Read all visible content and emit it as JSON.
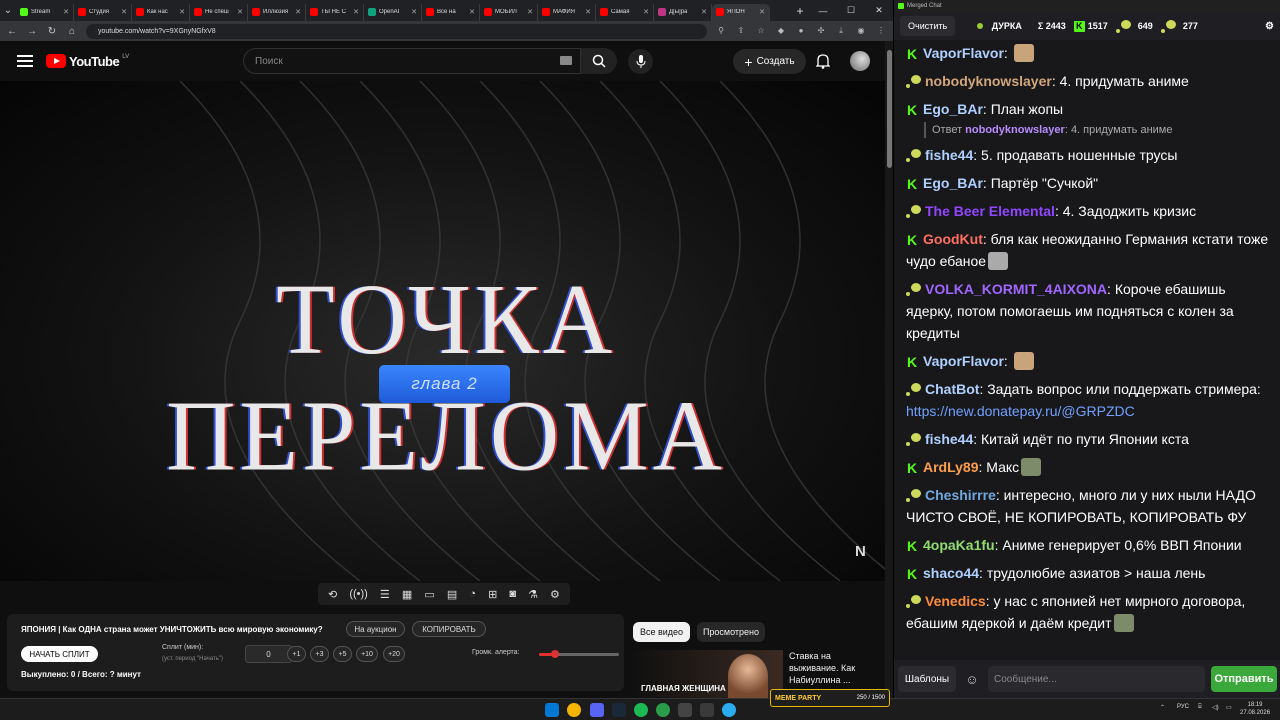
{
  "browser": {
    "tabs": [
      {
        "label": "Stream",
        "favicon": "kick"
      },
      {
        "label": "Студия",
        "favicon": "youtube"
      },
      {
        "label": "Как нас",
        "favicon": "youtube"
      },
      {
        "label": "Не спеш",
        "favicon": "youtube"
      },
      {
        "label": "Иллюзия",
        "favicon": "youtube"
      },
      {
        "label": "ТЫ НЕ С",
        "favicon": "youtube"
      },
      {
        "label": "OpenAI",
        "favicon": "openai"
      },
      {
        "label": "Все на",
        "favicon": "youtube"
      },
      {
        "label": "МОБИЛ",
        "favicon": "youtube"
      },
      {
        "label": "МАФИЯ",
        "favicon": "youtube"
      },
      {
        "label": "Самая",
        "favicon": "youtube"
      },
      {
        "label": "Д[ы]ра",
        "favicon": "instagram"
      },
      {
        "label": "ЯПОН",
        "favicon": "youtube",
        "active": true
      }
    ],
    "url": "youtube.com/watch?v=9XGnyNGfxV8"
  },
  "youtube": {
    "logo_text": "YouTube",
    "country_code": "LV",
    "search_placeholder": "Поиск",
    "create_label": "Создать"
  },
  "video": {
    "title_overlay": "ТОЧКА ПЕРЕЛОМА",
    "chapter": "глава 2"
  },
  "split_panel": {
    "title": "ЯПОНИЯ | Как ОДНА страна может УНИЧТОЖИТЬ всю мировую экономику?",
    "auction_btn": "На аукцион",
    "copy_btn": "КОПИРОВАТЬ",
    "start_btn": "НАЧАТЬ СПЛИТ",
    "split_label": "Сплит (мин):",
    "split_hint": "(уст. период \"Начать\")",
    "split_value": "0",
    "increments": [
      "+1",
      "+3",
      "+5",
      "+10",
      "+20"
    ],
    "alert_volume_label": "Громк. алерта:",
    "alert_volume_fraction": 0.2,
    "status": "Выкуплено: 0 / Всего: ? минут"
  },
  "recommendations": {
    "chips": [
      "Все видео",
      "Просмотрено"
    ],
    "card_thumb_text": "ГЛАВНАЯ ЖЕНЩИНА",
    "card_title": "Ставка на выживание. Как Набиуллина ..."
  },
  "meme_party": {
    "label": "MEME PARTY",
    "progress": "250 / 1500"
  },
  "chat": {
    "window_title": "Merged Chat",
    "clear_btn": "Очистить",
    "channel": "ДУРКА",
    "total": "Σ 2443",
    "kick_count": "1517",
    "twitch_count": "649",
    "other_count": "277",
    "messages": [
      {
        "platform": "kick",
        "user": "VaporFlavor",
        "color": "#b0d0ff",
        "text": "",
        "emote": true
      },
      {
        "platform": "twitch",
        "user": "nobodyknowslayer",
        "color": "#d2a679",
        "text": "4. придумать аниме"
      },
      {
        "platform": "kick",
        "user": "Ego_BAr",
        "color": "#b0d0ff",
        "text": "План жопы"
      },
      {
        "platform": "twitch",
        "user": "fishe44",
        "color": "#b0d0ff",
        "text": "5. продавать ношенные трусы"
      },
      {
        "platform": "kick",
        "user": "Ego_BAr",
        "color": "#b0d0ff",
        "text": "Партёр \"Сучкой\""
      },
      {
        "platform": "twitch",
        "user": "The Beer Elemental",
        "color": "#9146ff",
        "text": "4. Задоджить кризис"
      },
      {
        "platform": "kick",
        "user": "GoodKut",
        "color": "#ff6f61",
        "text": "бля как неожиданно Германия кстати тоже чудо ебаное",
        "emote": true
      },
      {
        "platform": "twitch",
        "user": "VOLKA_KORMIT_4AIXONA",
        "color": "#a066ff",
        "text": "Короче ебашишь ядерку, потом помогаешь им подняться с колен за кредиты"
      },
      {
        "platform": "kick",
        "user": "VaporFlavor",
        "color": "#b0d0ff",
        "text": "",
        "emote": true
      },
      {
        "platform": "twitch",
        "user": "ChatBot",
        "color": "#b0d0ff",
        "text": "Задать вопрос или поддержать стримера: ",
        "link": "https://new.donatepay.ru/@GRPZDC"
      },
      {
        "platform": "twitch",
        "user": "fishe44",
        "color": "#b0d0ff",
        "text": "Китай идёт по пути Японии кста"
      },
      {
        "platform": "kick",
        "user": "ArdLy89",
        "color": "#ff9e4d",
        "text": "Макс",
        "emote": true
      },
      {
        "platform": "twitch",
        "user": "Cheshirrre",
        "color": "#6fa8dc",
        "text": "интересно, много ли у них ныли НАДО ЧИСТО СВОЁ, НЕ КОПИРОВАТЬ, КОПИРОВАТЬ ФУ"
      },
      {
        "platform": "kick",
        "user": "4opaKa1fu",
        "color": "#8fdc6f",
        "text": "Аниме генерирует 0,6% ВВП Японии"
      },
      {
        "platform": "kick",
        "user": "shaco44",
        "color": "#b0d0ff",
        "text": "трудолюбие азиатов > наша лень"
      },
      {
        "platform": "twitch",
        "user": "Venedics",
        "color": "#ff8c3a",
        "text": "у нас с японией нет мирного договора, ебашим ядеркой и даём кредит",
        "emote": true
      }
    ],
    "reply": {
      "prefix": "Ответ",
      "user": "nobodyknowslayer",
      "text": "4. придумать аниме"
    },
    "templates_btn": "Шаблоны",
    "input_placeholder": "Сообщение...",
    "send_btn": "Отправить"
  },
  "taskbar": {
    "lang": "РУС",
    "time": "18:19",
    "date": "27.08.2026"
  }
}
